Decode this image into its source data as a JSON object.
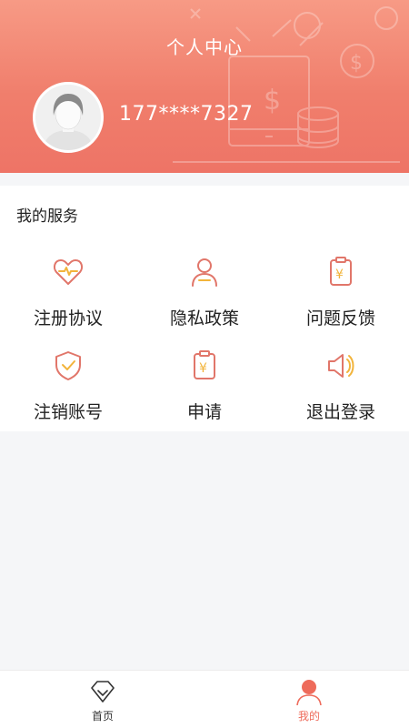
{
  "header": {
    "title": "个人中心",
    "phone": "177****7327",
    "background_color": "#f07e6c"
  },
  "services": {
    "title": "我的服务",
    "items": [
      {
        "label": "注册协议",
        "icon": "heart-pulse-icon"
      },
      {
        "label": "隐私政策",
        "icon": "person-icon"
      },
      {
        "label": "问题反馈",
        "icon": "clipboard-yen-icon"
      },
      {
        "label": "注销账号",
        "icon": "shield-check-icon"
      },
      {
        "label": "申请",
        "icon": "clipboard-yen-icon"
      },
      {
        "label": "退出登录",
        "icon": "speaker-icon"
      }
    ]
  },
  "tabbar": {
    "items": [
      {
        "label": "首页",
        "icon": "diamond-icon",
        "active": false
      },
      {
        "label": "我的",
        "icon": "user-icon",
        "active": true
      }
    ],
    "active_color": "#ee6b5b"
  }
}
